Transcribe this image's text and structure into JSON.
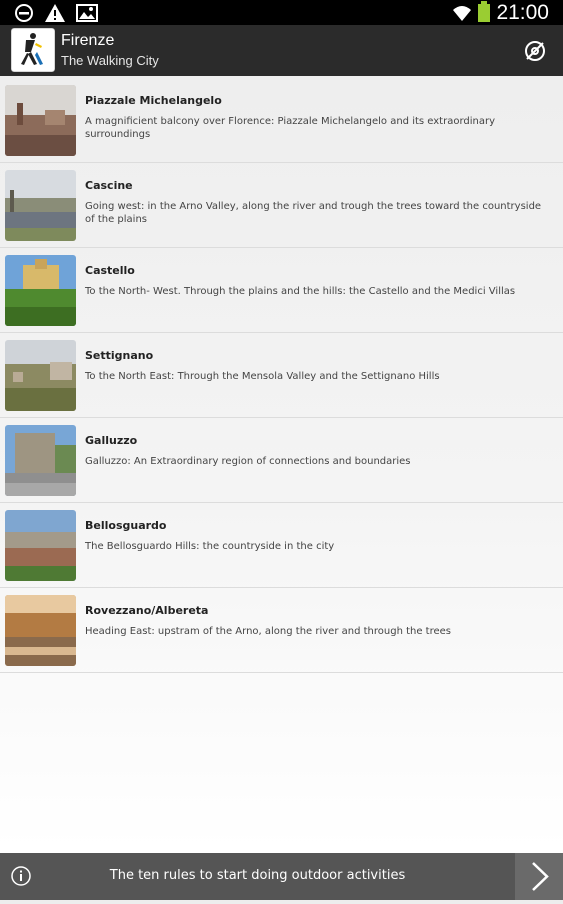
{
  "status_bar": {
    "time": "21:00",
    "icons": [
      "do-not-disturb-icon",
      "warning-icon",
      "image-icon",
      "wifi-icon",
      "battery-icon"
    ],
    "battery_color": "#9acd32"
  },
  "header": {
    "title": "Firenze",
    "subtitle": "The Walking City",
    "action_icon": "no-location-icon"
  },
  "routes": [
    {
      "title": "Piazzale Michelangelo",
      "description": "A magnificient balcony over Florence: Piazzale Michelangelo and its extraordinary surroundings"
    },
    {
      "title": "Cascine",
      "description": "Going west: in the Arno Valley, along the river and trough the trees toward the countryside of the plains"
    },
    {
      "title": "Castello",
      "description": "To the North- West. Through the plains and the hills: the Castello and the Medici Villas"
    },
    {
      "title": "Settignano",
      "description": "To the North East: Through the Mensola Valley and the Settignano Hills"
    },
    {
      "title": "Galluzzo",
      "description": "Galluzzo: An Extraordinary region of connections and boundaries"
    },
    {
      "title": "Bellosguardo",
      "description": "The Bellosguardo Hills: the countryside in the city"
    },
    {
      "title": "Rovezzano/Albereta",
      "description": "Heading East: upstram of the Arno, along the river and through the trees"
    }
  ],
  "footer": {
    "text": "The ten rules to start doing outdoor activities",
    "info_icon": "info-icon",
    "next_icon": "chevron-right-icon"
  }
}
